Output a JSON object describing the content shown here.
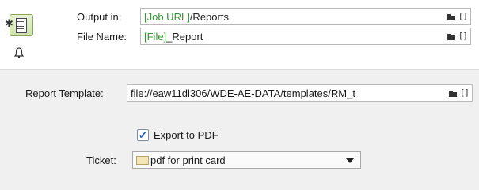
{
  "output": {
    "label": "Output in:",
    "value_variable": "[Job URL]",
    "value_rest": "/Reports"
  },
  "file_name": {
    "label": "File Name:",
    "value_variable": "[File]",
    "value_rest": "_Report"
  },
  "report_template": {
    "label": "Report Template:",
    "value": "file://eaw11dl306/WDE-AE-DATA/templates/RM_t"
  },
  "export_pdf": {
    "label": "Export to PDF",
    "checked": true
  },
  "ticket": {
    "label": "Ticket:",
    "selected": "pdf for print card"
  },
  "icons": {
    "node": "report-node-icon",
    "bell": "bell-icon",
    "folder": "folder-icon",
    "variable": "variable-brackets-icon"
  },
  "colors": {
    "variable_text": "#2e9b2e",
    "checkmark": "#1f5fbf",
    "panel_bg": "#f0f0f0"
  }
}
